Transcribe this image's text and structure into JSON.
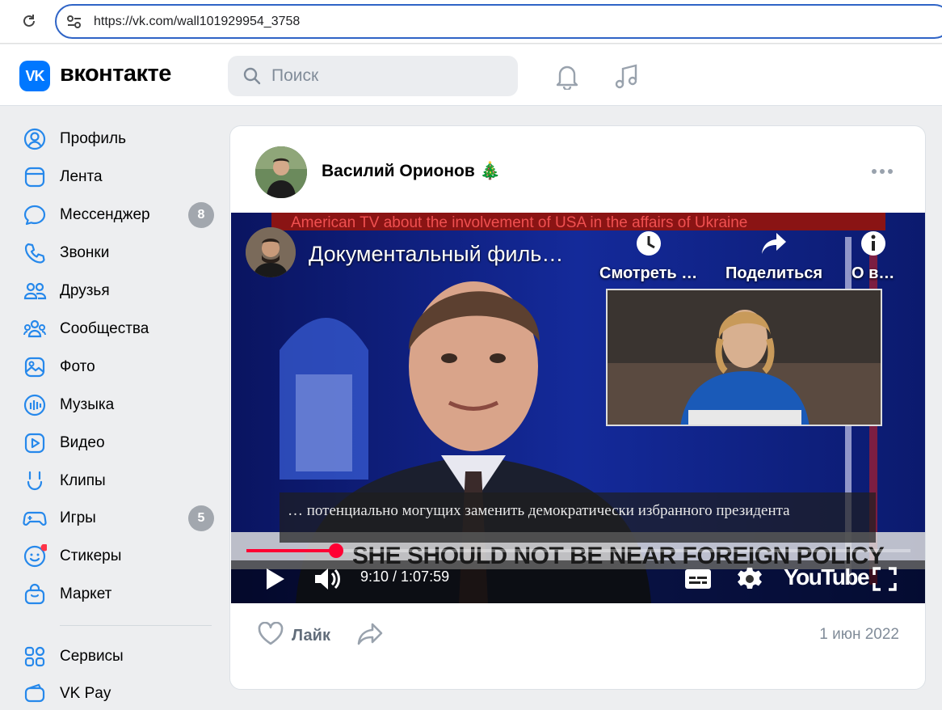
{
  "browser": {
    "url": "https://vk.com/wall101929954_3758"
  },
  "header": {
    "logo_text": "VK",
    "wordmark": "вконтакте",
    "search_placeholder": "Поиск",
    "icons": [
      "bell-icon",
      "music-note-icon"
    ]
  },
  "sidebar": {
    "items": [
      {
        "label": "Профиль",
        "icon": "user-circle-icon"
      },
      {
        "label": "Лента",
        "icon": "feed-icon"
      },
      {
        "label": "Мессенджер",
        "icon": "chat-bubble-icon",
        "badge": "8"
      },
      {
        "label": "Звонки",
        "icon": "phone-icon"
      },
      {
        "label": "Друзья",
        "icon": "friends-icon"
      },
      {
        "label": "Сообщества",
        "icon": "communities-icon"
      },
      {
        "label": "Фото",
        "icon": "photo-icon"
      },
      {
        "label": "Музыка",
        "icon": "music-icon"
      },
      {
        "label": "Видео",
        "icon": "video-icon"
      },
      {
        "label": "Клипы",
        "icon": "clips-icon"
      },
      {
        "label": "Игры",
        "icon": "gamepad-icon",
        "badge": "5"
      },
      {
        "label": "Стикеры",
        "icon": "smiley-icon"
      },
      {
        "label": "Маркет",
        "icon": "shopping-bag-icon"
      },
      {
        "label": "Сервисы",
        "icon": "services-grid-icon"
      },
      {
        "label": "VK Pay",
        "icon": "wallet-icon"
      }
    ]
  },
  "post": {
    "author": "Василий Орионов 🎄",
    "date": "1 июн 2022",
    "like_label": "Лайк",
    "video": {
      "banner": "American TV about the involvement of USA in the affairs of Ukraine",
      "title": "Документальный филь…",
      "actions": [
        {
          "label": "Смотреть …",
          "icon": "clock-icon"
        },
        {
          "label": "Поделиться",
          "icon": "share-arrow-icon"
        },
        {
          "label": "О в…",
          "icon": "info-icon"
        }
      ],
      "subtitles": "… потенциально могущих заменить демократически избранного президента",
      "ticker": "SHE SHOULD NOT BE NEAR FOREIGN POLICY",
      "time": "9:10 / 1:07:59",
      "progress": 0.135,
      "youtube_label": "YouTube"
    }
  },
  "colors": {
    "accent": "#0077ff",
    "progress": "#ff0033",
    "badge": "#a2a7ae"
  }
}
